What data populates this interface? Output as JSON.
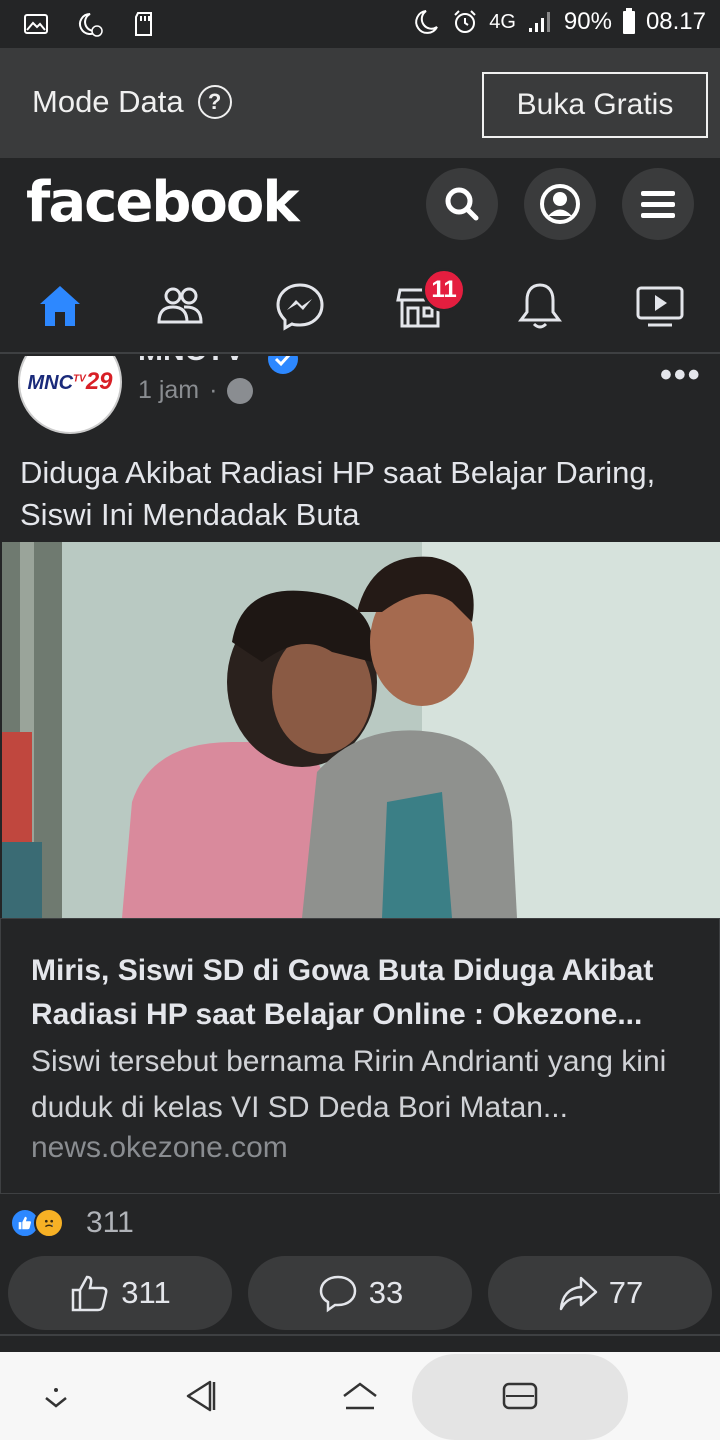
{
  "status_bar": {
    "left_icons": [
      "image-icon",
      "do-not-disturb-icon",
      "sd-card-icon"
    ],
    "network": "4G",
    "battery": "90%",
    "time": "08.17"
  },
  "data_banner": {
    "label": "Mode Data",
    "help": "?",
    "button": "Buka Gratis"
  },
  "header": {
    "logo": "facebook",
    "marketplace_badge": "11"
  },
  "post": {
    "page_name": "MNCTV",
    "avatar_text_main": "MNC",
    "avatar_text_tv": "TV",
    "avatar_text_num": "29",
    "time": "1 jam",
    "dot": "·",
    "more": "•••",
    "caption": "Diduga Akibat Radiasi HP saat Belajar Daring, Siswi Ini Mendadak Buta",
    "link_title": "Miris, Siswi SD di Gowa Buta Diduga Akibat Radiasi HP saat Belajar Online : Okezone...",
    "link_desc": "Siswi tersebut bernama Ririn Andrianti yang kini duduk di kelas VI SD Deda Bori Matan...",
    "link_source": "news.okezone.com",
    "reaction_count": "311",
    "actions": {
      "like": "311",
      "comment": "33",
      "share": "77"
    }
  },
  "colors": {
    "background": "#242526",
    "accent": "#2d88ff",
    "badge": "#e41e3f"
  }
}
